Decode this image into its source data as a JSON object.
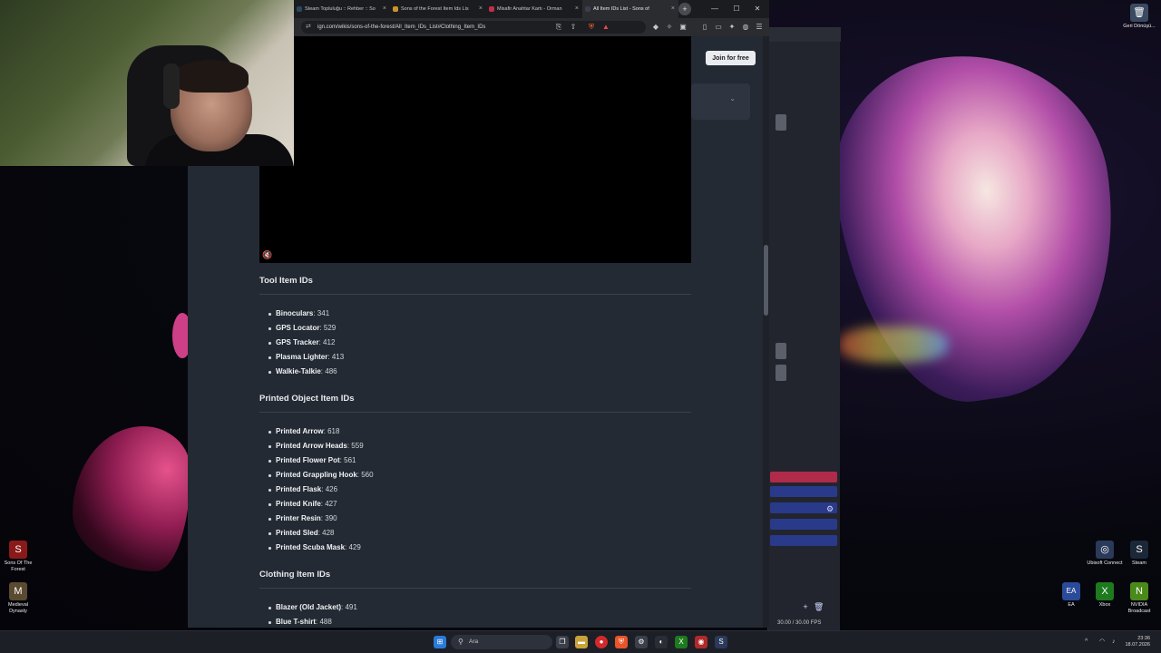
{
  "browser": {
    "tabs": [
      {
        "title": "Steam Topluluğu :: Rehber :: So",
        "icon_color": "#2a475e",
        "active": false
      },
      {
        "title": "Sons of the Forest Item Ids Lis",
        "icon_color": "#c9952a",
        "active": false
      },
      {
        "title": "Misafir Anahtar Kartı - Orman",
        "icon_color": "#c0304a",
        "active": false
      },
      {
        "title": "All Item IDs List - Sons of",
        "icon_color": "#3a3f4a",
        "active": true
      }
    ],
    "url": "ign.com/wikis/sons-of-the-forest/All_Item_IDs_List#Clothing_Item_IDs",
    "window_controls": [
      "—",
      "☐",
      "✕"
    ]
  },
  "page": {
    "join_button": "Join for free",
    "sections": [
      {
        "heading": "Tool Item IDs",
        "items": [
          {
            "name": "Binoculars",
            "id": "341"
          },
          {
            "name": "GPS Locator",
            "id": "529"
          },
          {
            "name": "GPS Tracker",
            "id": "412"
          },
          {
            "name": "Plasma Lighter",
            "id": "413"
          },
          {
            "name": "Walkie-Talkie",
            "id": "486"
          }
        ]
      },
      {
        "heading": "Printed Object Item IDs",
        "items": [
          {
            "name": "Printed Arrow",
            "id": "618"
          },
          {
            "name": "Printed Arrow Heads",
            "id": "559"
          },
          {
            "name": "Printed Flower Pot",
            "id": "561"
          },
          {
            "name": "Printed Grappling Hook",
            "id": "560"
          },
          {
            "name": "Printed Flask",
            "id": "426"
          },
          {
            "name": "Printed Knife",
            "id": "427"
          },
          {
            "name": "Printer Resin",
            "id": "390"
          },
          {
            "name": "Printed Sled",
            "id": "428"
          },
          {
            "name": "Printed Scuba Mask",
            "id": "429"
          }
        ]
      },
      {
        "heading": "Clothing Item IDs",
        "items": [
          {
            "name": "Blazer (Old Jacket)",
            "id": "491"
          },
          {
            "name": "Blue T-shirt",
            "id": "488"
          }
        ]
      }
    ]
  },
  "obs": {
    "fps": "30.00 / 30.00 FPS"
  },
  "desktop_icons": [
    {
      "label": "Geri Dönüşü...",
      "glyph": "🗑",
      "color": "#3a4a60"
    },
    {
      "label": "Sons Of The Forest",
      "glyph": "S",
      "color": "#8a1a1a"
    },
    {
      "label": "Medieval Dynasty",
      "glyph": "M",
      "color": "#5a4a30"
    },
    {
      "label": "Ubisoft Connect",
      "glyph": "◎",
      "color": "#2a3a5a"
    },
    {
      "label": "Steam",
      "glyph": "S",
      "color": "#1b2838"
    },
    {
      "label": "EA",
      "glyph": "EA",
      "color": "#2a4a9a"
    },
    {
      "label": "Xbox",
      "glyph": "X",
      "color": "#1e7a1e"
    },
    {
      "label": "NVIDIA Broadcast",
      "glyph": "N",
      "color": "#4a8a1a"
    }
  ],
  "taskbar": {
    "search_placeholder": "Ara",
    "time": "23:36",
    "date": "18.07.2026"
  }
}
